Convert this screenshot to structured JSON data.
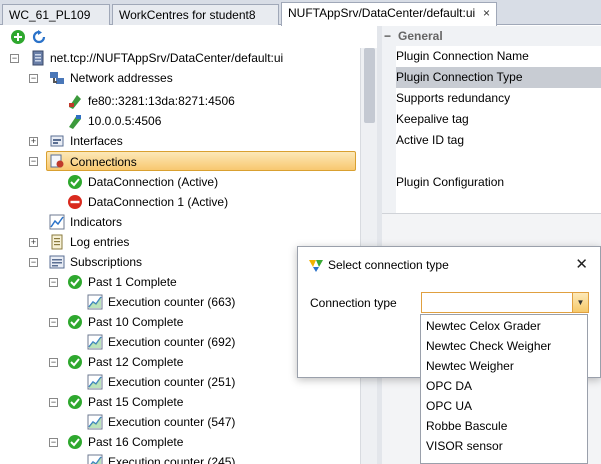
{
  "tabs": [
    {
      "label": "WC_61_PL109"
    },
    {
      "label": "WorkCentres for student8"
    },
    {
      "label": "NUFTAppSrv/DataCenter/default:ui",
      "close": "×"
    }
  ],
  "toolbar": {
    "add_icon": "add-icon",
    "refresh_icon": "refresh-icon"
  },
  "tree": {
    "root": "net.tcp://NUFTAppSrv/DataCenter/default:ui",
    "network_addresses": "Network addresses",
    "address_1": "fe80::3281:13da:8271:4506",
    "address_2": "10.0.0.5:4506",
    "interfaces": "Interfaces",
    "connections": "Connections",
    "connection_1": "DataConnection (Active)",
    "connection_2": "DataConnection 1 (Active)",
    "indicators": "Indicators",
    "log_entries": "Log entries",
    "subscriptions": "Subscriptions",
    "subs": [
      {
        "label": "Past 1 Complete",
        "counter": "Execution counter (663)"
      },
      {
        "label": "Past 10 Complete",
        "counter": "Execution counter (692)"
      },
      {
        "label": "Past 12 Complete",
        "counter": "Execution counter (251)"
      },
      {
        "label": "Past 15 Complete",
        "counter": "Execution counter (547)"
      },
      {
        "label": "Past 16 Complete",
        "counter": "Execution counter (245)"
      }
    ]
  },
  "properties": {
    "category": "General",
    "rows": [
      "Plugin Connection Name",
      "Plugin Connection Type",
      "Supports redundancy",
      "Keepalive tag",
      "Active ID tag",
      "",
      "Plugin Configuration"
    ]
  },
  "dialog": {
    "title": "Select connection type",
    "close": "✕",
    "field_label": "Connection type",
    "value": "",
    "options": [
      "Newtec Celox Grader",
      "Newtec Check Weigher",
      "Newtec Weigher",
      "OPC DA",
      "OPC UA",
      "Robbe Bascule",
      "VISOR sensor"
    ]
  },
  "colors": {
    "selection": "#f8c870",
    "active_check": "#2ea82e",
    "inactive_stop": "#d92a1e"
  }
}
